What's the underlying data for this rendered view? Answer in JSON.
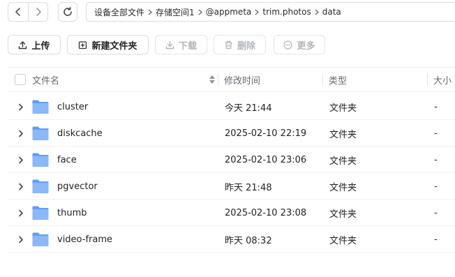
{
  "nav": {
    "back_icon": "chevron-left-icon",
    "forward_icon": "chevron-right-icon",
    "refresh_icon": "refresh-icon",
    "breadcrumbs": [
      "设备全部文件",
      "存储空间1",
      "@appmeta",
      "trim.photos",
      "data"
    ]
  },
  "toolbar": {
    "upload": "上传",
    "new_folder": "新建文件夹",
    "download": "下载",
    "delete": "删除",
    "more": "更多"
  },
  "table": {
    "headers": {
      "name": "文件名",
      "modified": "修改时间",
      "type": "类型",
      "size": "大小"
    },
    "rows": [
      {
        "name": "cluster",
        "modified": "今天 21:44",
        "type": "文件夹",
        "size": "-"
      },
      {
        "name": "diskcache",
        "modified": "2025-02-10 22:19",
        "type": "文件夹",
        "size": "-"
      },
      {
        "name": "face",
        "modified": "2025-02-10 23:06",
        "type": "文件夹",
        "size": "-"
      },
      {
        "name": "pgvector",
        "modified": "昨天 21:48",
        "type": "文件夹",
        "size": "-"
      },
      {
        "name": "thumb",
        "modified": "2025-02-10 23:08",
        "type": "文件夹",
        "size": "-"
      },
      {
        "name": "video-frame",
        "modified": "昨天 08:32",
        "type": "文件夹",
        "size": "-"
      }
    ]
  },
  "colors": {
    "folder": "#5b9cf5",
    "folder_light": "#8ab8f8",
    "border": "#d9dce1",
    "disabled_text": "#b3b6bb",
    "header_text": "#666b73"
  }
}
